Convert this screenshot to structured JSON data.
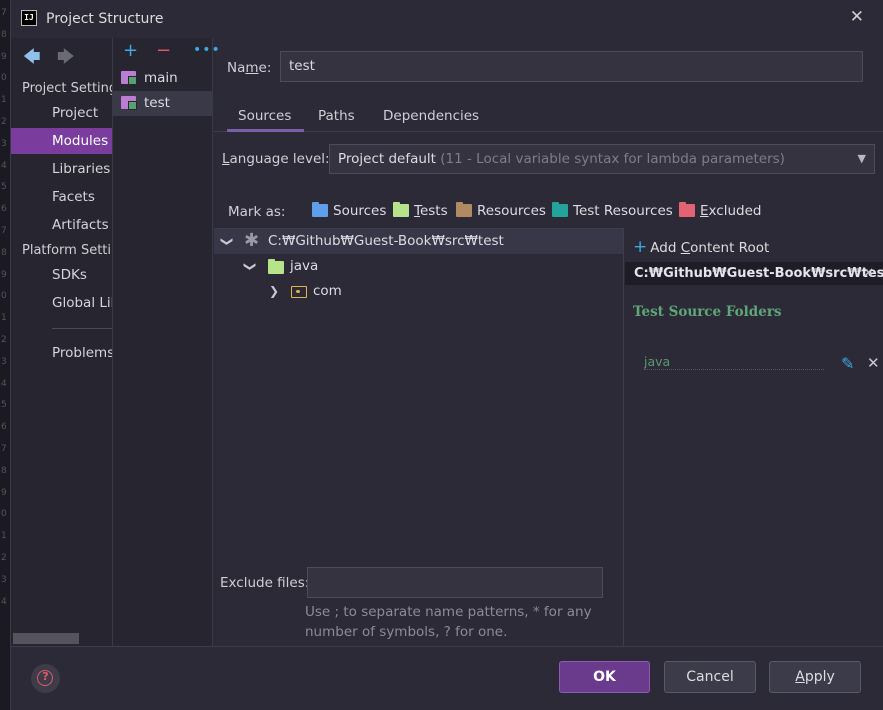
{
  "gutter_numbers": [
    "7",
    "8",
    "9",
    "0",
    "1",
    "2",
    "3",
    "4",
    "5",
    "6",
    "7",
    "8",
    "9",
    "0",
    "1",
    "2",
    "3",
    "4",
    "5",
    "6",
    "7",
    "8",
    "9",
    "0",
    "1",
    "2",
    "3",
    "4"
  ],
  "window": {
    "title": "Project Structure",
    "app_icon": "IJ"
  },
  "nav": {
    "project_settings_header": "Project Settings",
    "project_settings": [
      "Project",
      "Modules",
      "Libraries",
      "Facets",
      "Artifacts"
    ],
    "platform_settings_header": "Platform Settings",
    "platform_settings": [
      "SDKs",
      "Global Libraries"
    ],
    "problems": "Problems",
    "active": "Modules"
  },
  "modules": {
    "items": [
      "main",
      "test"
    ],
    "selected": "test"
  },
  "form": {
    "name_label_pre": "Na",
    "name_label_ul": "m",
    "name_label_post": "e:",
    "name_value": "test"
  },
  "tabs": [
    "Sources",
    "Paths",
    "Dependencies"
  ],
  "active_tab": "Sources",
  "language": {
    "label_ul": "L",
    "label_rest": "anguage level:",
    "value": "Project default",
    "hint": "(11 - Local variable syntax for lambda parameters)"
  },
  "mark_as": {
    "label": "Mark as:",
    "sources": "Sources",
    "tests_ul": "T",
    "tests_rest": "ests",
    "resources": "Resources",
    "test_resources": "Test Resources",
    "excluded_ul": "E",
    "excluded_rest": "xcluded"
  },
  "tree": {
    "root": "C:₩Github₩Guest-Book₩src₩test",
    "child": "java",
    "grandchild": "com"
  },
  "right_panel": {
    "add_pre": "Add ",
    "add_ul": "C",
    "add_post": "ontent Root",
    "root_path": "C:₩Github₩Guest-Book₩src₩test",
    "section_title": "Test Source Folders",
    "folder": "java"
  },
  "exclude": {
    "label": "Exclude files:",
    "hint": "Use ; to separate name patterns, * for any number of symbols, ? for one."
  },
  "buttons": {
    "help": "?",
    "ok": "OK",
    "cancel": "Cancel",
    "apply_ul": "A",
    "apply_rest": "pply"
  },
  "colors": {
    "active_nav": "#7a3d9e",
    "ok_button": "#6a3a8c",
    "test_green": "#5fa77a",
    "accent_blue": "#3ca9e3",
    "remove_red": "#e0566a"
  }
}
